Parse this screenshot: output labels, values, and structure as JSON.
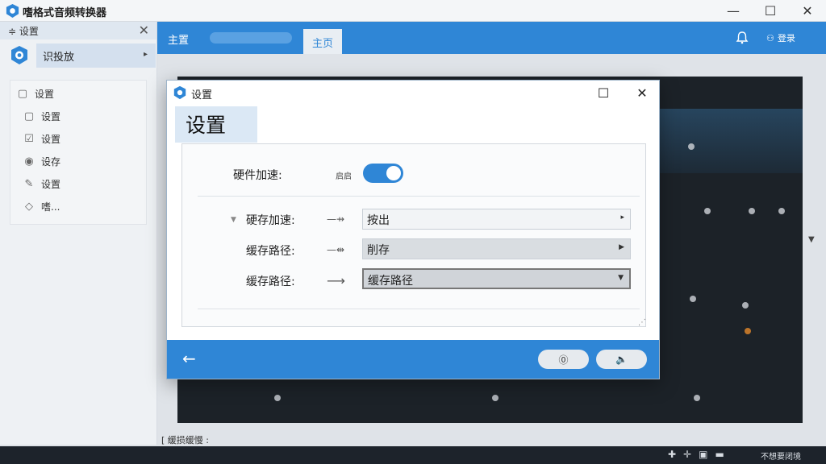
{
  "app": {
    "title": "嗜格式音频转换器"
  },
  "window_buttons": {
    "minimize": "—",
    "maximize": "☐",
    "close": "✕"
  },
  "sidebar": {
    "header": "≑ 设置",
    "close": "✕",
    "profile_label": "识投放",
    "profile_arrow": "▸",
    "items": [
      {
        "label": "设置",
        "icon": "square-icon"
      },
      {
        "label": "设置",
        "icon": "square-icon"
      },
      {
        "label": "设置",
        "icon": "checkbox-icon"
      },
      {
        "label": "设存",
        "icon": "radio-icon"
      },
      {
        "label": "设置",
        "icon": "edit-icon"
      },
      {
        "label": "嗜...",
        "icon": "diamond-icon"
      }
    ]
  },
  "tabs": {
    "home": "主置",
    "active": "主页"
  },
  "header_right": {
    "login": "登录"
  },
  "bottom": {
    "path_label": "[ 缓损缓慢 :",
    "status_text": "不想要闭境"
  },
  "dialog": {
    "title": "设置",
    "heading": "设置",
    "hw_accel": {
      "label": "硬件加速:",
      "toggle_label": "启启",
      "on": true
    },
    "rows": [
      {
        "label": "硬存加速:",
        "arrow": "—⇸",
        "value": "按出"
      },
      {
        "label": "缓存路径:",
        "arrow": "—⇹",
        "value": "削存"
      },
      {
        "label": "缓存路径:",
        "arrow": "⟶",
        "value": "缓存路径"
      }
    ],
    "footer": {
      "back": "←",
      "btn1": "⓪",
      "btn2": "🔈"
    }
  },
  "colors": {
    "accent": "#2f86d6",
    "workspace": "#1c2228",
    "statusbar": "#1d232b"
  }
}
